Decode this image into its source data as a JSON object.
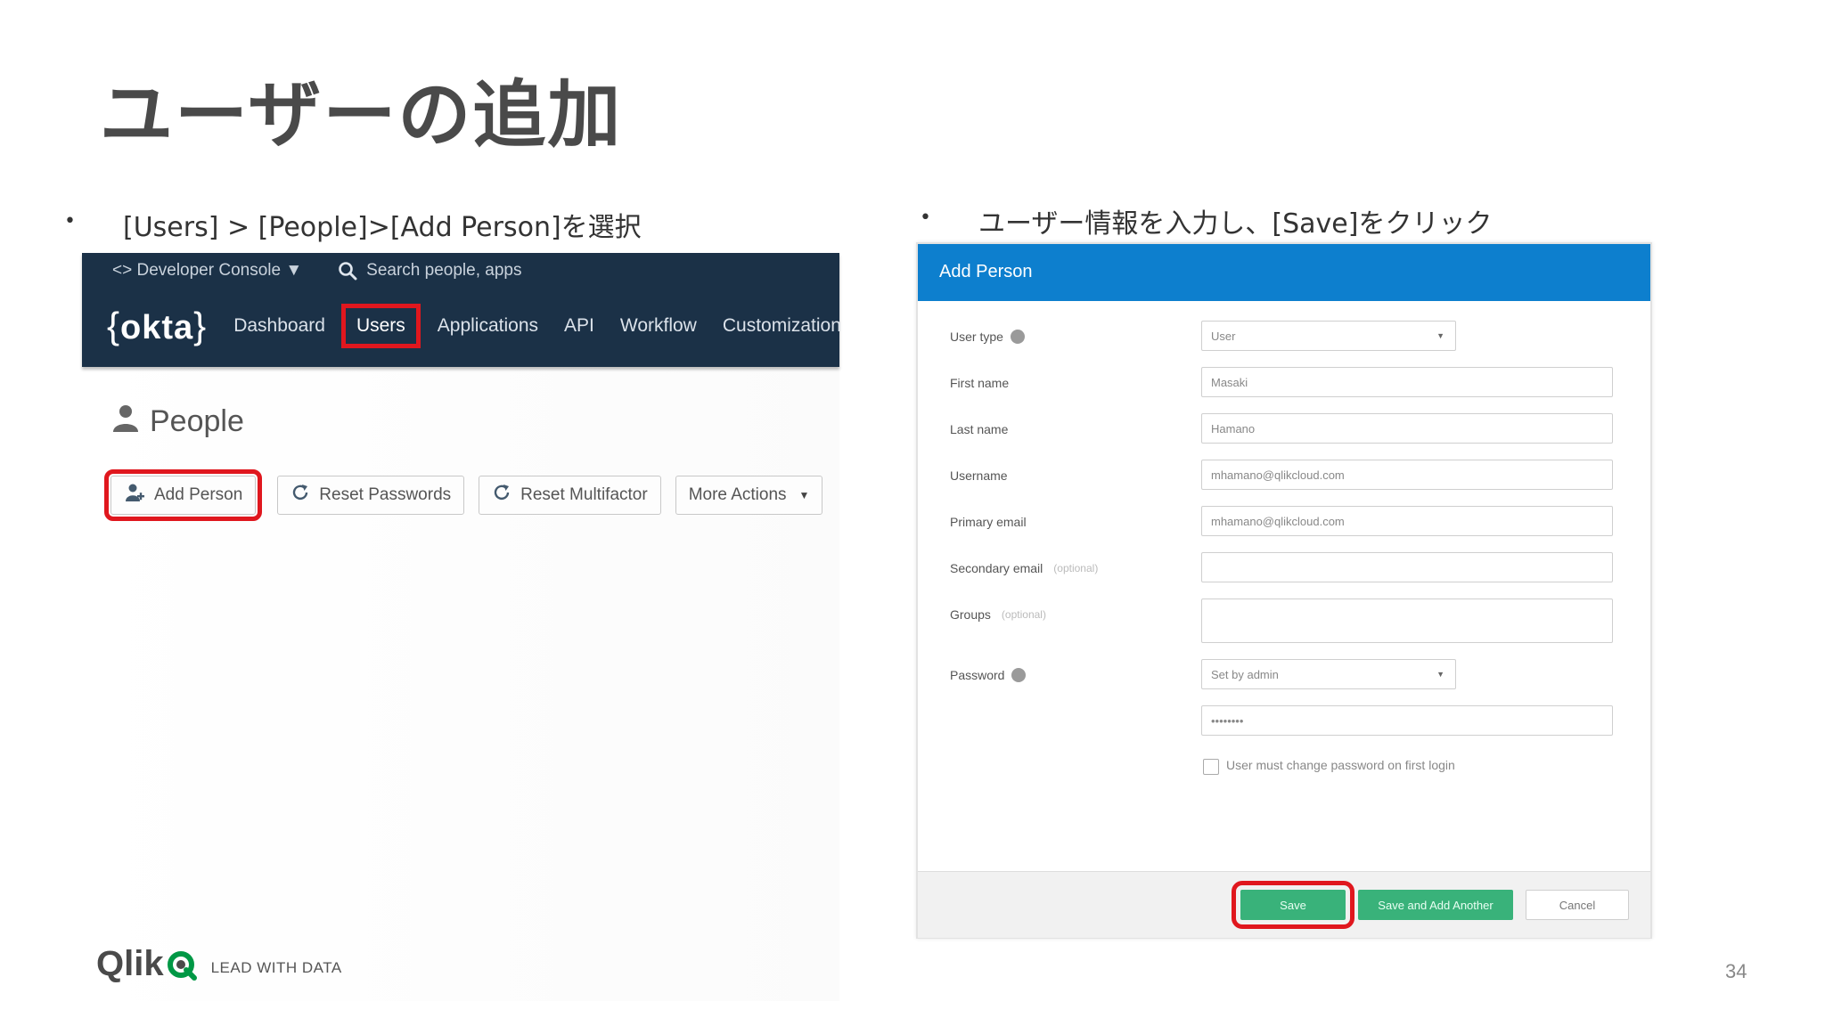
{
  "slide": {
    "title": "ユーザーの追加",
    "page_number": "34",
    "bullet_left": "[Users] > [People]>[Add  Person]を選択",
    "bullet_right": "ユーザー情報を入力し、[Save]をクリック",
    "bullet_char": "•"
  },
  "okta": {
    "dev_console": "<> Developer Console ▼",
    "search_placeholder": "Search people, apps",
    "logo_text": "okta",
    "nav": [
      "Dashboard",
      "Users",
      "Applications",
      "API",
      "Workflow",
      "Customization"
    ],
    "page_title": "People",
    "buttons": {
      "add_person": "Add Person",
      "reset_passwords": "Reset Passwords",
      "reset_multifactor": "Reset Multifactor",
      "more_actions": "More Actions"
    },
    "highlight_color": "#e0171e",
    "topbar_color": "#1b3147"
  },
  "dialog": {
    "title": "Add Person",
    "header_color": "#0d7fce",
    "labels": {
      "user_type": "User type",
      "first_name": "First name",
      "last_name": "Last name",
      "username": "Username",
      "primary_email": "Primary email",
      "secondary_email": "Secondary email",
      "groups": "Groups",
      "password": "Password",
      "optional": "(optional)"
    },
    "values": {
      "user_type": "User",
      "first_name": "Masaki",
      "last_name": "Hamano",
      "username": "mhamano@qlikcloud.com",
      "primary_email": "mhamano@qlikcloud.com",
      "secondary_email": "",
      "groups": "",
      "password_mode": "Set by admin",
      "password": "••••••••"
    },
    "checkbox_label": "User must change password on first login",
    "footer": {
      "save": "Save",
      "save_add": "Save and Add Another",
      "cancel": "Cancel"
    },
    "save_color": "#39b27a"
  },
  "branding": {
    "wordmark": "Qlik",
    "tagline": "LEAD WITH DATA",
    "accent": "#009845"
  }
}
